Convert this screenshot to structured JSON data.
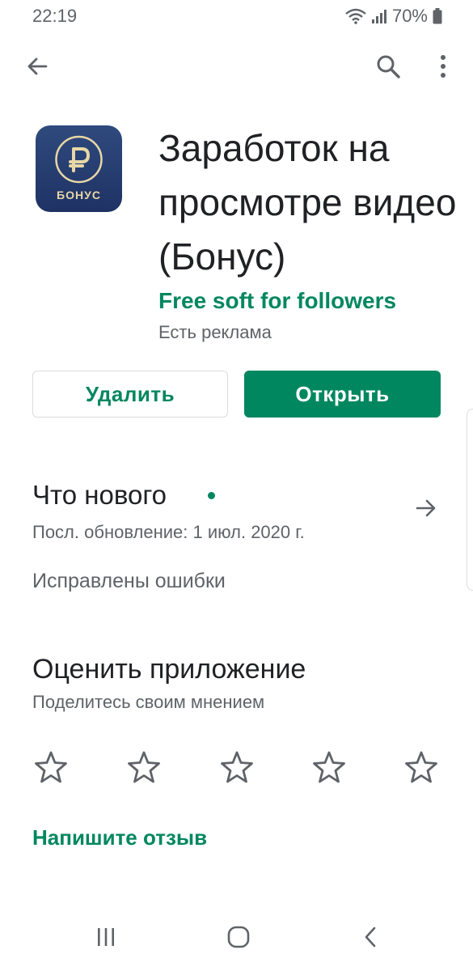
{
  "status_bar": {
    "time": "22:19",
    "battery": "70%"
  },
  "app_bar": {
    "back_icon": "arrow-back-icon",
    "search_icon": "search-icon",
    "more_icon": "more-vert-icon"
  },
  "app": {
    "icon_label": "БОНУС",
    "title": "Заработок на просмотре видео (Бонус)",
    "developer": "Free soft for followers",
    "ads_note": "Есть реклама"
  },
  "actions": {
    "uninstall_label": "Удалить",
    "open_label": "Открыть"
  },
  "whats_new": {
    "title": "Что нового",
    "updated": "Посл. обновление: 1 июл. 2020 г.",
    "changelog": "Исправлены ошибки"
  },
  "rating": {
    "title": "Оценить приложение",
    "subtitle": "Поделитесь своим мнением",
    "stars_total": 5,
    "stars_selected": 0,
    "write_review_label": "Напишите отзыв"
  },
  "colors": {
    "accent": "#01875f",
    "text_primary": "#202124",
    "text_secondary": "#5f6368",
    "icon_bg": "#24386c",
    "icon_gold": "#e8d7a6"
  }
}
